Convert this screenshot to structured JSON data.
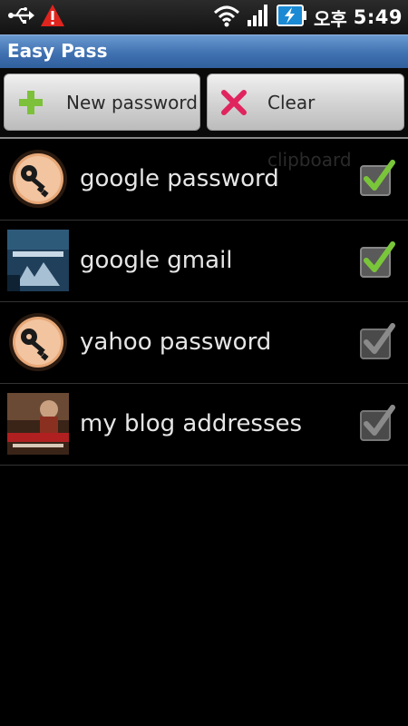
{
  "status_bar": {
    "icons": [
      "usb-icon",
      "warning-icon",
      "wifi-icon",
      "signal-icon",
      "battery-charging-icon"
    ],
    "ampm": "오후",
    "time": "5:49"
  },
  "app": {
    "title": "Easy Pass"
  },
  "toolbar": {
    "new_label": "New password",
    "clear_label": "Clear clipboard",
    "new_icon": "plus-icon",
    "clear_icon": "x-icon",
    "new_icon_color": "#7dc13a",
    "clear_icon_color": "#e0245e"
  },
  "entries": [
    {
      "label": "google password",
      "thumb": "key-icon",
      "checked": true
    },
    {
      "label": "google gmail",
      "thumb": "photo-thumbnail",
      "checked": true
    },
    {
      "label": "yahoo password",
      "thumb": "key-icon",
      "checked": false
    },
    {
      "label": "my blog addresses",
      "thumb": "photo-thumbnail",
      "checked": false
    }
  ],
  "colors": {
    "check_on": "#7ac63a",
    "check_off": "#8a8a8a",
    "title_bar": "#3f70b0"
  }
}
